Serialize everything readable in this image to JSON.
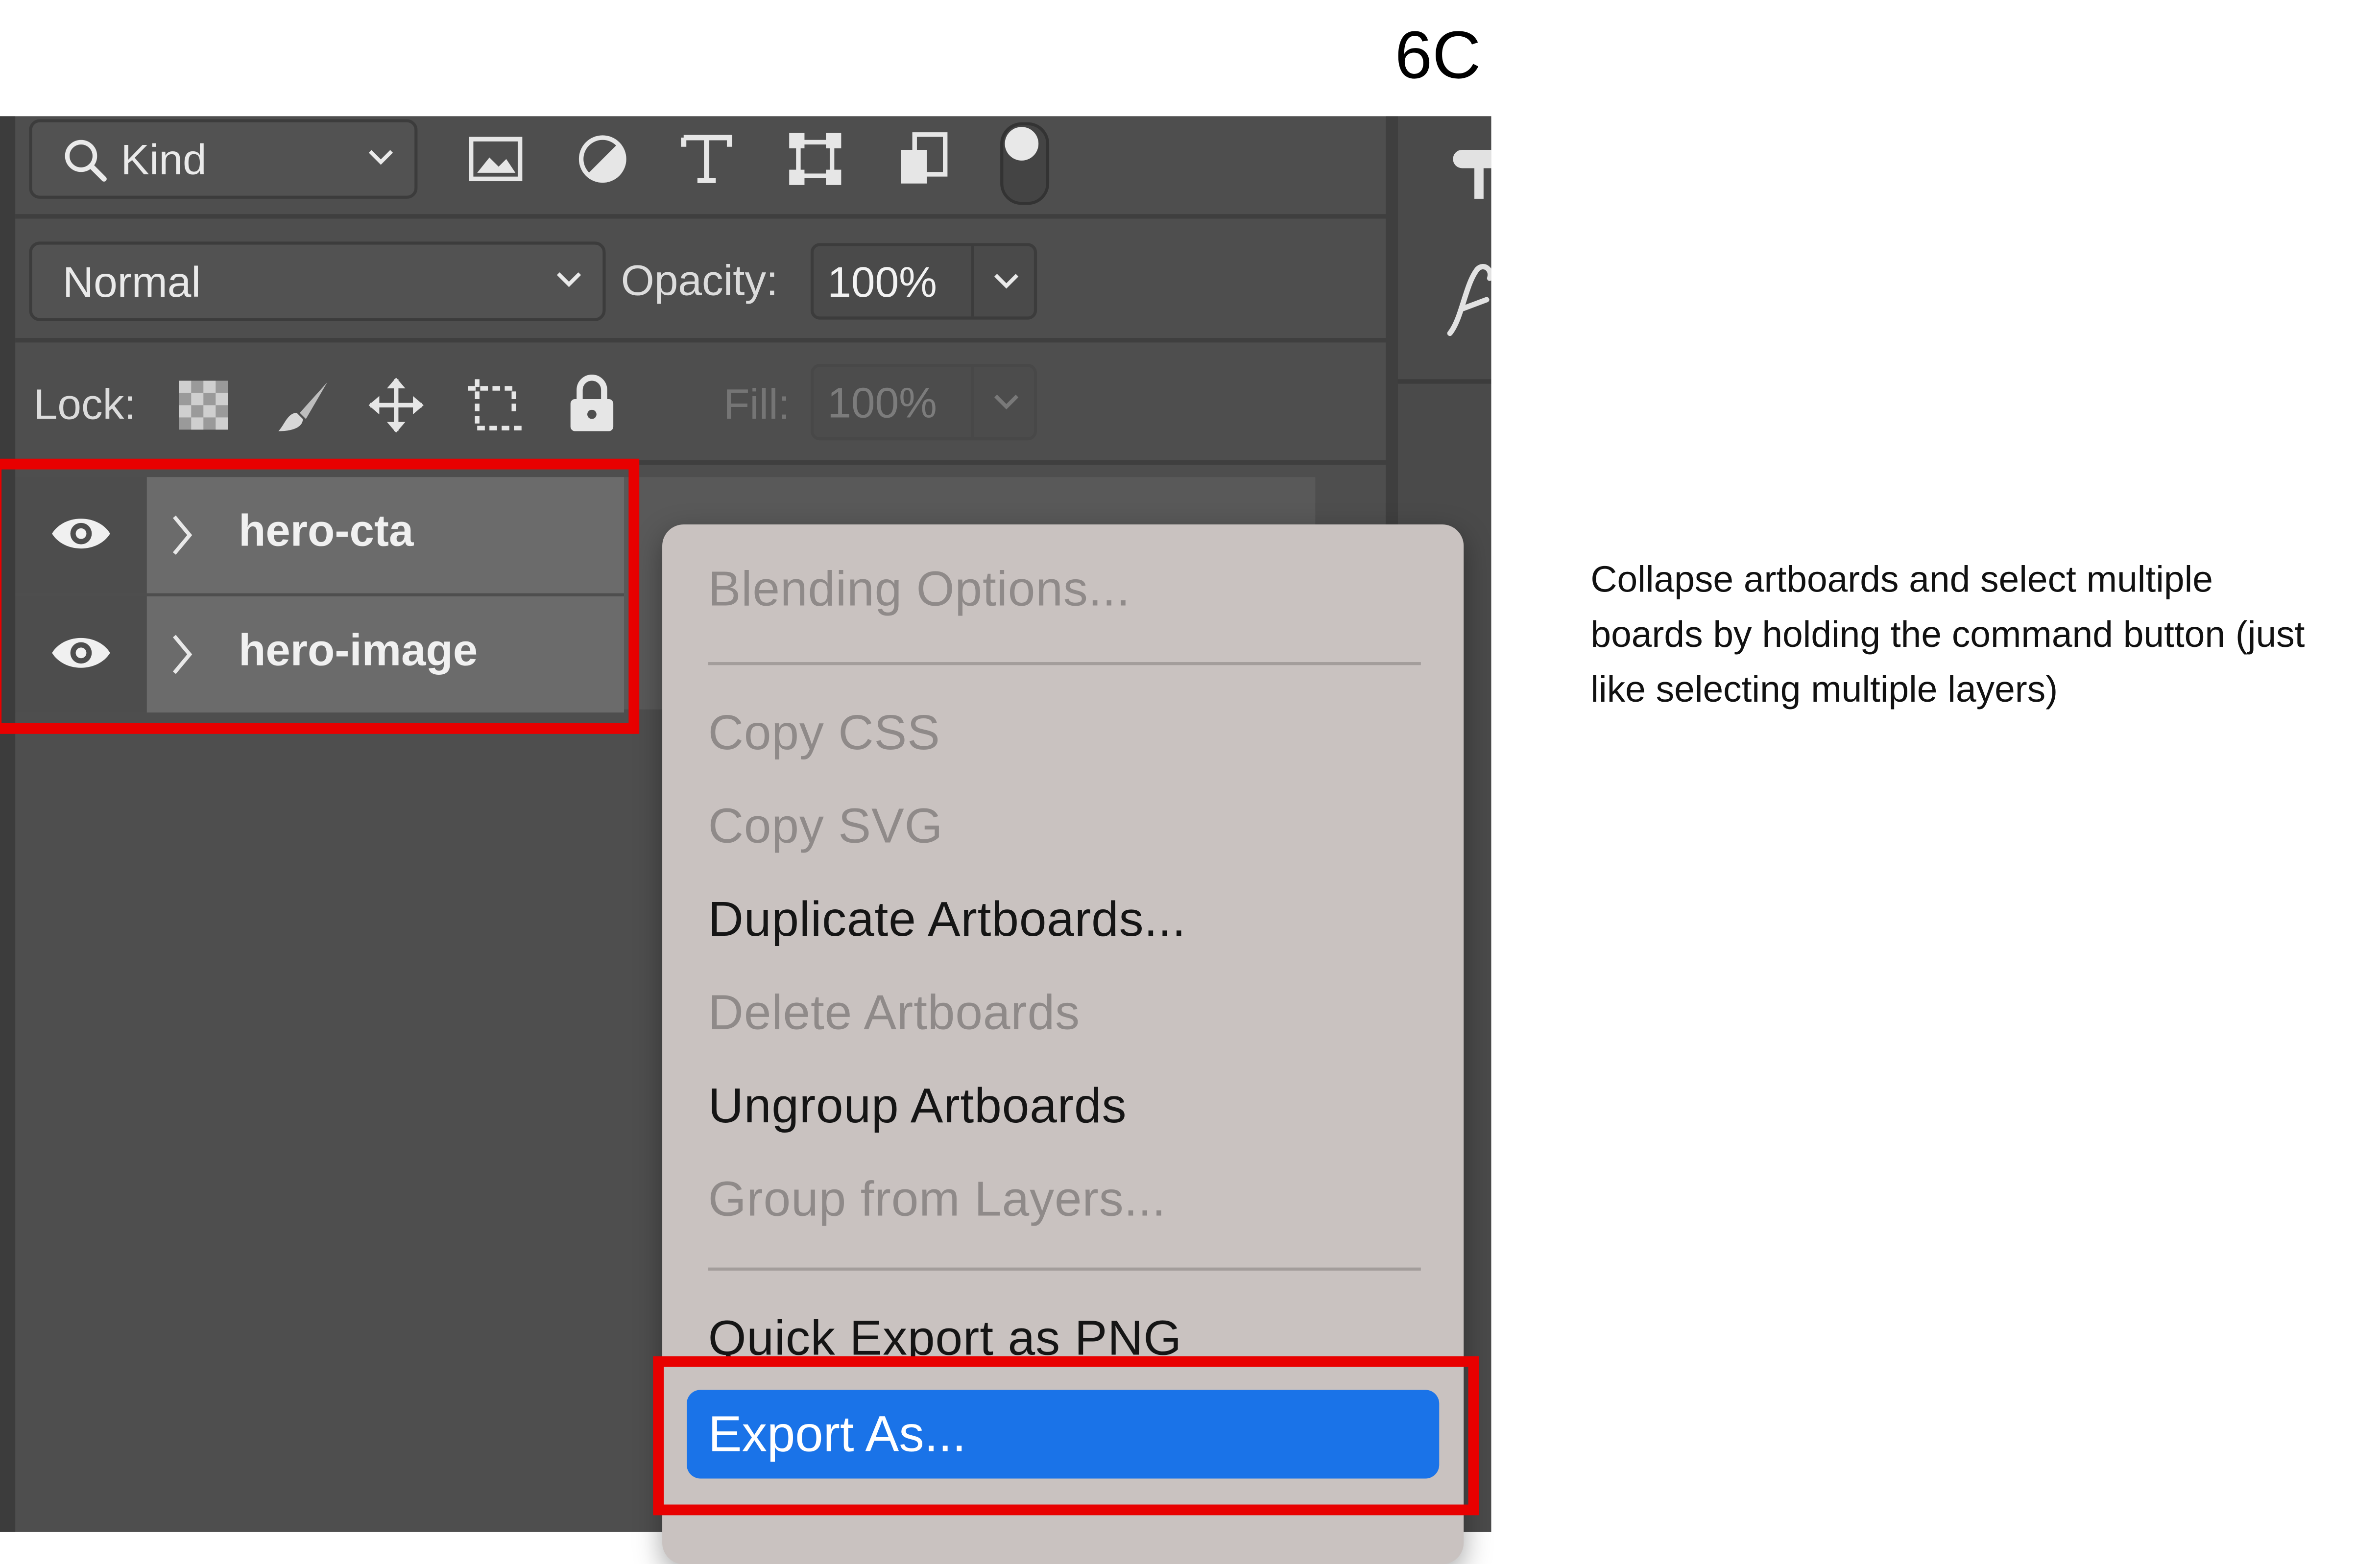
{
  "slide": {
    "label": "6C"
  },
  "annotation": {
    "text": "Collapse artboards and select multiple boards by holding the command button (just like selecting multiple layers)"
  },
  "filter": {
    "kind_label": "Kind",
    "tool_icons": [
      "image-filter-icon",
      "adjustment-filter-icon",
      "type-filter-icon",
      "shape-filter-icon",
      "smart-object-filter-icon",
      "filter-toggle-icon"
    ]
  },
  "blend": {
    "mode": "Normal",
    "opacity_label": "Opacity:",
    "opacity_value": "100%"
  },
  "lock": {
    "label": "Lock:",
    "fill_label": "Fill:",
    "fill_value": "100%",
    "icons": [
      "lock-transparent-pixels-icon",
      "lock-image-pixels-icon",
      "lock-position-icon",
      "lock-artboard-icon",
      "lock-all-icon"
    ]
  },
  "layers": [
    {
      "name": "hero-cta"
    },
    {
      "name": "hero-image"
    }
  ],
  "context_menu": {
    "items": [
      {
        "label": "Blending Options...",
        "state": "disabled"
      },
      {
        "label": "Copy CSS",
        "state": "disabled"
      },
      {
        "label": "Copy SVG",
        "state": "disabled"
      },
      {
        "label": "Duplicate Artboards...",
        "state": "enabled"
      },
      {
        "label": "Delete Artboards",
        "state": "disabled"
      },
      {
        "label": "Ungroup Artboards",
        "state": "enabled"
      },
      {
        "label": "Group from Layers...",
        "state": "disabled"
      },
      {
        "label": "Quick Export as PNG",
        "state": "enabled"
      },
      {
        "label": "Export As...",
        "state": "highlighted"
      }
    ]
  },
  "colors": {
    "highlight_box": "#e80000",
    "menu_selection": "#1a73e8",
    "panel_bg": "#4e4e4e",
    "menu_bg": "#c9c2c0"
  }
}
